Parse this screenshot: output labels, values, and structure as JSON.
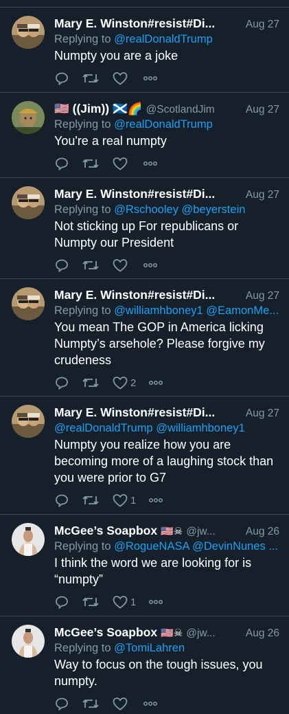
{
  "tweets": [
    {
      "name": "Mary E. Winston#resist#Di...",
      "handle": "",
      "flags": "",
      "date": "Aug 27",
      "reply_prefix": "Replying to",
      "reply_to": "@realDonaldTrump",
      "text": "Numpty you are a joke",
      "likes": ""
    },
    {
      "name": "🇺🇸 ((Jim)) 🏴󠁧󠁢󠁳󠁣󠁴󠁿🌈",
      "handle": "@ScotlandJim",
      "flags": "",
      "date": "Aug 27",
      "reply_prefix": "Replying to",
      "reply_to": "@realDonaldTrump",
      "text": "You're a real numpty",
      "likes": ""
    },
    {
      "name": "Mary E. Winston#resist#Di...",
      "handle": "",
      "flags": "",
      "date": "Aug 27",
      "reply_prefix": "Replying to",
      "reply_to": "@Rschooley @beyerstein",
      "text": "Not sticking up For republicans or Numpty our President",
      "likes": ""
    },
    {
      "name": "Mary E. Winston#resist#Di...",
      "handle": "",
      "flags": "",
      "date": "Aug 27",
      "reply_prefix": "Replying to",
      "reply_to": "@williamhboney1 @EamonMe...",
      "text": "You mean The GOP in America licking Numpty’s arsehole? Please forgive my crudeness",
      "likes": "2"
    },
    {
      "name": "Mary E. Winston#resist#Di...",
      "handle": "",
      "flags": "",
      "date": "Aug 27",
      "reply_prefix": "",
      "reply_to": "@realDonaldTrump  @williamhboney1",
      "text": "Numpty you realize how you are becoming more of a laughing stock than you were prior to G7",
      "likes": "1"
    },
    {
      "name": "McGee’s Soapbox",
      "handle": "@jw...",
      "flags": "🇺🇸☠",
      "date": "Aug 26",
      "reply_prefix": "Replying to",
      "reply_to": "@RogueNASA @DevinNunes ...",
      "text": "I think the word we are looking for is “numpty”",
      "likes": "1"
    },
    {
      "name": "McGee’s Soapbox",
      "handle": "@jw...",
      "flags": "🇺🇸☠",
      "date": "Aug 26",
      "reply_prefix": "Replying to",
      "reply_to": "@TomiLahren",
      "text": "Way to focus on the tough issues, you numpty.",
      "likes": ""
    }
  ],
  "icons": {
    "reply": "reply-icon",
    "retweet": "retweet-icon",
    "like": "heart-icon",
    "more": "more-icon"
  },
  "colors": {
    "background": "#15202b",
    "secondary_text": "#8899a6",
    "link": "#1da1f2",
    "divider": "#38444d"
  }
}
